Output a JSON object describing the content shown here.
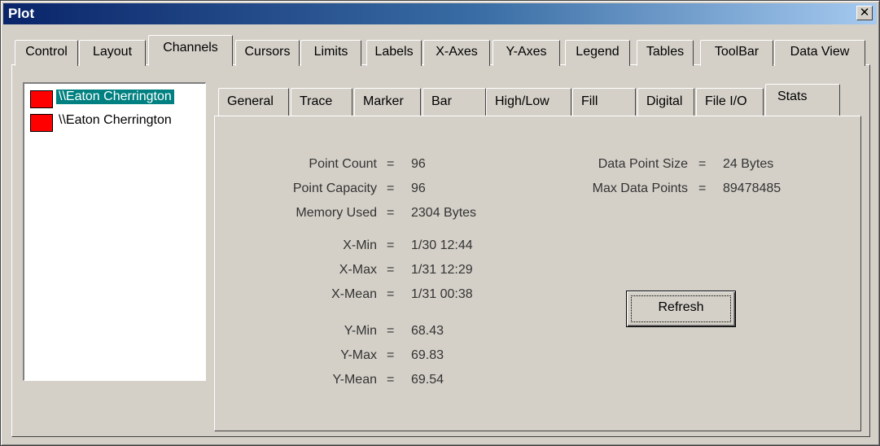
{
  "window": {
    "title": "Plot"
  },
  "tabs": [
    "Control",
    "Layout",
    "Channels",
    "Cursors",
    "Limits",
    "Labels",
    "X-Axes",
    "Y-Axes",
    "Legend",
    "Tables",
    "ToolBar",
    "Data View"
  ],
  "active_tab": "Channels",
  "channels": [
    {
      "label": "\\\\Eaton Cherrington",
      "color": "#ff0000",
      "selected": true
    },
    {
      "label": "\\\\Eaton Cherrington",
      "color": "#ff0000",
      "selected": false
    }
  ],
  "subtabs": [
    "General",
    "Trace",
    "Marker",
    "Bar",
    "High/Low",
    "Fill",
    "Digital",
    "File I/O",
    "Stats"
  ],
  "active_subtab": "Stats",
  "stats_left": [
    {
      "key": "Point Count",
      "value": "96"
    },
    {
      "key": "Point Capacity",
      "value": "96"
    },
    {
      "key": "Memory Used",
      "value": "2304 Bytes"
    },
    {
      "key": "X-Min",
      "value": "1/30 12:44"
    },
    {
      "key": "X-Max",
      "value": "1/31 12:29"
    },
    {
      "key": "X-Mean",
      "value": "1/31 00:38"
    },
    {
      "key": "Y-Min",
      "value": "68.43"
    },
    {
      "key": "Y-Max",
      "value": "69.83"
    },
    {
      "key": "Y-Mean",
      "value": "69.54"
    }
  ],
  "stats_right": [
    {
      "key": "Data Point Size",
      "value": "24 Bytes"
    },
    {
      "key": "Max Data Points",
      "value": "89478485"
    }
  ],
  "equals": "=",
  "buttons": {
    "refresh": "Refresh",
    "close": "✕"
  },
  "colors": {
    "titlebar": "#0a246a",
    "selection": "#008080",
    "face": "#d4d0c8"
  }
}
